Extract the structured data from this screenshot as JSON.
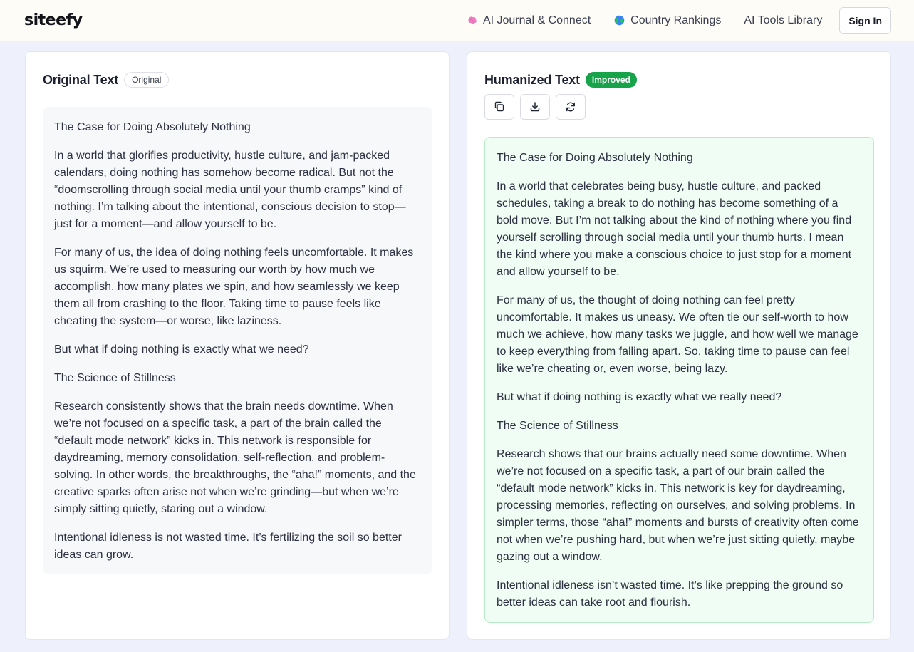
{
  "header": {
    "logo": "siteefy",
    "nav": [
      {
        "label": "AI Journal & Connect",
        "icon": "brain-icon"
      },
      {
        "label": "Country Rankings",
        "icon": "globe-icon"
      },
      {
        "label": "AI Tools Library"
      }
    ],
    "signin_label": "Sign In"
  },
  "colors": {
    "accent_green": "#16a34a",
    "improved_box_bg": "#effdf4",
    "original_box_bg": "#f7f8fa"
  },
  "original": {
    "title": "Original Text",
    "badge": "Original",
    "paragraphs": [
      "The Case for Doing Absolutely Nothing",
      "In a world that glorifies productivity, hustle culture, and jam-packed calendars, doing nothing has somehow become radical. But not the “doomscrolling through social media until your thumb cramps” kind of nothing. I’m talking about the intentional, conscious decision to stop—just for a moment—and allow yourself to be.",
      "For many of us, the idea of doing nothing feels uncomfortable. It makes us squirm. We're used to measuring our worth by how much we accomplish, how many plates we spin, and how seamlessly we keep them all from crashing to the floor. Taking time to pause feels like cheating the system—or worse, like laziness.",
      "But what if doing nothing is exactly what we need?",
      "The Science of Stillness",
      "Research consistently shows that the brain needs downtime. When we’re not focused on a specific task, a part of the brain called the “default mode network” kicks in. This network is responsible for daydreaming, memory consolidation, self-reflection, and problem-solving. In other words, the breakthroughs, the “aha!” moments, and the creative sparks often arise not when we’re grinding—but when we’re simply sitting quietly, staring out a window.",
      "Intentional idleness is not wasted time. It’s fertilizing the soil so better ideas can grow."
    ]
  },
  "humanized": {
    "title": "Humanized Text",
    "badge": "Improved",
    "tools": [
      {
        "name": "copy-button",
        "icon": "copy-icon"
      },
      {
        "name": "download-button",
        "icon": "download-icon"
      },
      {
        "name": "regenerate-button",
        "icon": "refresh-icon"
      }
    ],
    "paragraphs": [
      "The Case for Doing Absolutely Nothing",
      "In a world that celebrates being busy, hustle culture, and packed schedules, taking a break to do nothing has become something of a bold move. But I’m not talking about the kind of nothing where you find yourself scrolling through social media until your thumb hurts. I mean the kind where you make a conscious choice to just stop for a moment and allow yourself to be.",
      "For many of us, the thought of doing nothing can feel pretty uncomfortable. It makes us uneasy. We often tie our self-worth to how much we achieve, how many tasks we juggle, and how well we manage to keep everything from falling apart. So, taking time to pause can feel like we’re cheating or, even worse, being lazy.",
      "But what if doing nothing is exactly what we really need?",
      "The Science of Stillness",
      "Research shows that our brains actually need some downtime. When we’re not focused on a specific task, a part of our brain called the “default mode network” kicks in. This network is key for daydreaming, processing memories, reflecting on ourselves, and solving problems. In simpler terms, those “aha!” moments and bursts of creativity often come not when we’re pushing hard, but when we’re just sitting quietly, maybe gazing out a window.",
      "Intentional idleness isn’t wasted time. It’s like prepping the ground so better ideas can take root and flourish."
    ]
  }
}
